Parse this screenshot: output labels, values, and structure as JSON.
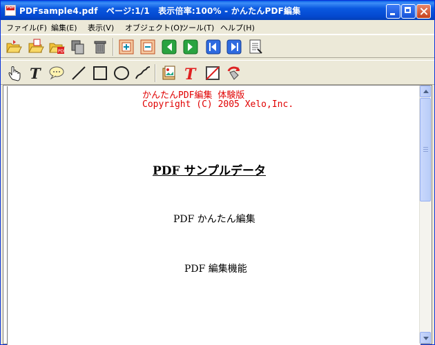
{
  "window": {
    "title": "PDFsample4.pdf　ページ:1/1　表示倍率:100% - かんたんPDF編集"
  },
  "menu": {
    "items": [
      {
        "label": "ファイル(F)"
      },
      {
        "label": "編集(E)"
      },
      {
        "label": "表示(V)"
      },
      {
        "label": "オブジェクト(O)"
      },
      {
        "label": "ツール(T)"
      },
      {
        "label": "ヘルプ(H)"
      }
    ]
  },
  "toolbar1": {
    "icons": [
      "open-folder-icon",
      "open-folder-alt-icon",
      "open-pdf-icon",
      "copy-pages-icon",
      "trash-icon",
      "insert-page-icon",
      "extract-page-icon",
      "first-page-icon",
      "next-page-icon",
      "back-page-icon",
      "last-page-icon",
      "document-properties-icon"
    ]
  },
  "toolbar2": {
    "icons": [
      "hand-pointer-icon",
      "text-tool-icon",
      "comment-bubble-icon",
      "line-tool-icon",
      "rectangle-tool-icon",
      "ellipse-tool-icon",
      "freehand-tool-icon",
      "image-insert-icon",
      "red-text-icon",
      "no-fill-icon",
      "rotate-icon"
    ]
  },
  "document": {
    "watermark_line1": "かんたんPDF編集 体験版",
    "watermark_line2": "Copyright (C) 2005 Xelo,Inc.",
    "heading": "PDF サンプルデータ",
    "line1": "PDF かんたん編集",
    "line2": "PDF 編集機能"
  },
  "colors": {
    "titlebar": "#0a58e0",
    "watermark": "#e00000",
    "chrome": "#ece9d8"
  }
}
